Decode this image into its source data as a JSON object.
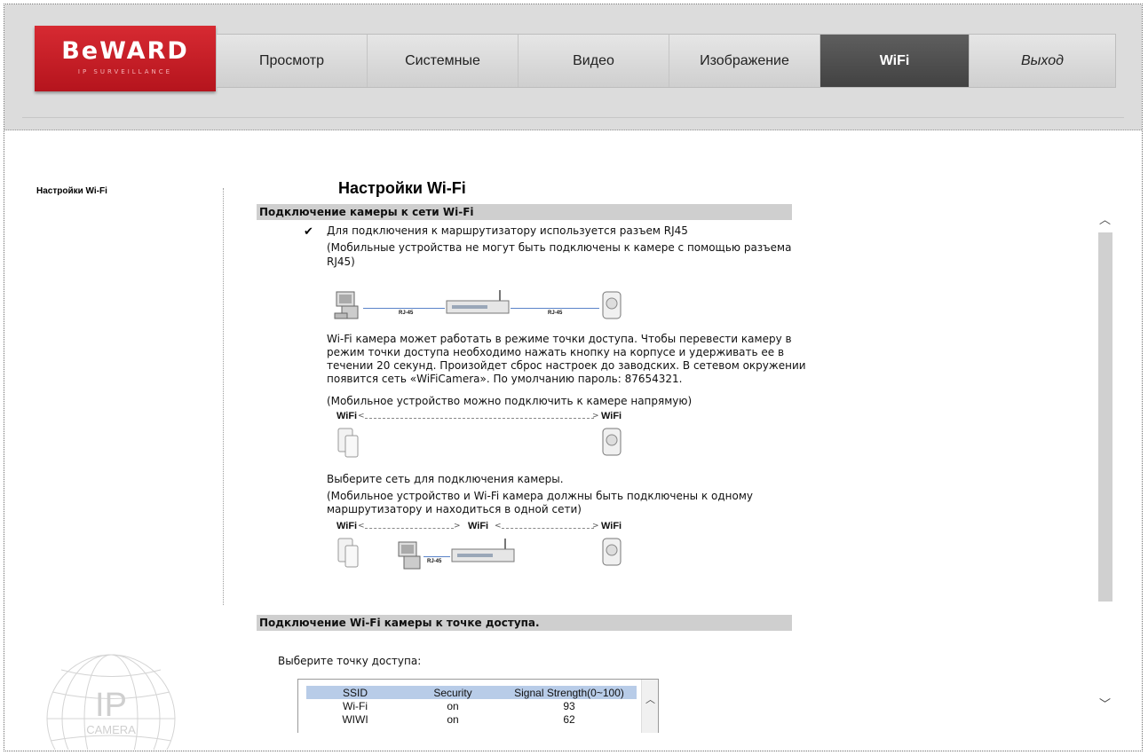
{
  "header": {
    "logo_text": "BeWARD",
    "logo_sub": "IP SURVEILLANCE",
    "nav": [
      {
        "label": "Просмотр"
      },
      {
        "label": "Системные"
      },
      {
        "label": "Видео"
      },
      {
        "label": "Изображение"
      },
      {
        "label": "WiFi"
      },
      {
        "label": "Выход"
      }
    ],
    "active_nav": "WiFi"
  },
  "sidebar": {
    "items": [
      {
        "label": "Настройки Wi-Fi"
      }
    ],
    "watermark": {
      "ip": "IP",
      "camera": "CAMERA"
    }
  },
  "main": {
    "title": "Настройки Wi-Fi",
    "section1": {
      "header": "Подключение камеры к сети Wi-Fi",
      "line1": "Для подключения к маршрутизатору используется разъем RJ45",
      "line2": "(Мобильные устройства не могут быть подключены к камере с помощью разъема",
      "line3": "RJ45)",
      "rj45_label": "RJ-45",
      "para1": [
        "Wi-Fi камера может работать в режиме точки доступа. Чтобы перевести камеру в",
        "режим точки доступа необходимо нажать кнопку на корпусе и удерживать ее в",
        "течении 20 секунд. Произойдет сброс настроек до заводских. В сетевом окружении",
        "появится сеть «WiFiCamera». По умолчанию пароль: 87654321."
      ],
      "para2": "(Мобильное устройство можно подключить к камере напрямую)",
      "wifi": "WiFi",
      "para3": "Выберите сеть для подключения камеры.",
      "para4": [
        "(Мобильное устройство и Wi-Fi камера должны быть подключены к одному",
        "маршрутизатору и находиться в одной сети)"
      ]
    },
    "section2": {
      "header": "Подключение Wi-Fi камеры к точке доступа.",
      "select_label": "Выберите точку доступа:",
      "columns": [
        "SSID",
        "Security",
        "Signal Strength(0~100)"
      ],
      "rows": [
        [
          "Wi-Fi",
          "on",
          "93"
        ],
        [
          "WIWI",
          "on",
          "62"
        ]
      ]
    }
  },
  "colors": {
    "brand_red": "#c81e26",
    "header_bg": "#dcdcdc",
    "active_tab": "#4f4f4f",
    "section_bar": "#cfcfcf",
    "table_header": "#b8cce8"
  }
}
